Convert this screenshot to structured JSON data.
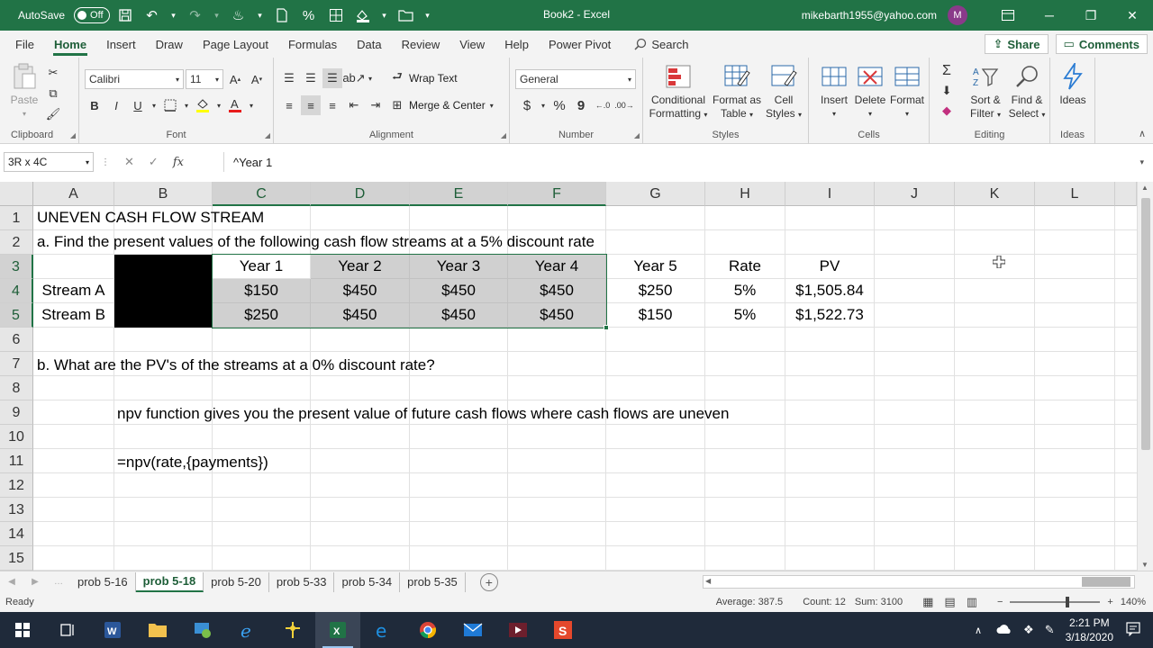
{
  "titlebar": {
    "autosave_label": "AutoSave",
    "autosave_state": "Off",
    "doc_title": "Book2  -  Excel",
    "user_email": "mikebarth1955@yahoo.com",
    "avatar_initial": "M"
  },
  "tabs": [
    "File",
    "Home",
    "Insert",
    "Draw",
    "Page Layout",
    "Formulas",
    "Data",
    "Review",
    "View",
    "Help",
    "Power Pivot"
  ],
  "active_tab": "Home",
  "search_label": "Search",
  "share_label": "Share",
  "comments_label": "Comments",
  "ribbon": {
    "clipboard": {
      "paste": "Paste",
      "label": "Clipboard"
    },
    "font": {
      "name": "Calibri",
      "size": "11",
      "label": "Font",
      "bold": "B",
      "italic": "I",
      "underline": "U"
    },
    "alignment": {
      "wrap": "Wrap Text",
      "merge": "Merge & Center",
      "label": "Alignment"
    },
    "number": {
      "format": "General",
      "label": "Number"
    },
    "styles": {
      "cond_line1": "Conditional",
      "cond_line2": "Formatting",
      "table_line1": "Format as",
      "table_line2": "Table",
      "cell_line1": "Cell",
      "cell_line2": "Styles",
      "label": "Styles"
    },
    "cells": {
      "insert": "Insert",
      "delete": "Delete",
      "format": "Format",
      "label": "Cells"
    },
    "editing": {
      "sort_line1": "Sort &",
      "sort_line2": "Filter",
      "find_line1": "Find &",
      "find_line2": "Select",
      "label": "Editing"
    },
    "ideas": {
      "btn": "Ideas",
      "label": "Ideas"
    }
  },
  "formula_bar": {
    "name_box": "3R x 4C",
    "fx": "fx",
    "content": "^Year 1"
  },
  "columns": [
    "A",
    "B",
    "C",
    "D",
    "E",
    "F",
    "G",
    "H",
    "I",
    "J",
    "K",
    "L"
  ],
  "rows": [
    "1",
    "2",
    "3",
    "4",
    "5",
    "6",
    "7",
    "8",
    "9",
    "10",
    "11",
    "12",
    "13",
    "14",
    "15"
  ],
  "cells": {
    "a1": "UNEVEN CASH FLOW STREAM",
    "a2": "a. Find the present values of the following cash flow streams at a 5% discount rate",
    "c3": "Year 1",
    "d3": "Year 2",
    "e3": "Year 3",
    "f3": "Year 4",
    "g3": "Year 5",
    "h3": "Rate",
    "i3": "PV",
    "a4": "Stream A",
    "c4": "$150",
    "d4": "$450",
    "e4": "$450",
    "f4": "$450",
    "g4": "$250",
    "h4": "5%",
    "i4": "$1,505.84",
    "a5": "Stream B",
    "c5": "$250",
    "d5": "$450",
    "e5": "$450",
    "f5": "$450",
    "g5": "$150",
    "h5": "5%",
    "i5": "$1,522.73",
    "a7": "b. What are the PV's of the streams at a 0% discount rate?",
    "b9": "npv function gives you the present value of future cash flows where cash flows are uneven",
    "b11": "=npv(rate,{payments})"
  },
  "sheets": [
    "prob 5-16",
    "prob 5-18",
    "prob 5-20",
    "prob 5-33",
    "prob 5-34",
    "prob 5-35"
  ],
  "active_sheet": "prob 5-18",
  "status": {
    "ready": "Ready",
    "average": "Average: 387.5",
    "count": "Count: 12",
    "sum": "Sum: 3100",
    "zoom": "140%"
  },
  "clock": {
    "time": "2:21 PM",
    "date": "3/18/2020"
  },
  "colors": {
    "excel_green": "#217346",
    "selection_gray": "#d0d0d0",
    "taskbar": "#1f2a3a"
  }
}
